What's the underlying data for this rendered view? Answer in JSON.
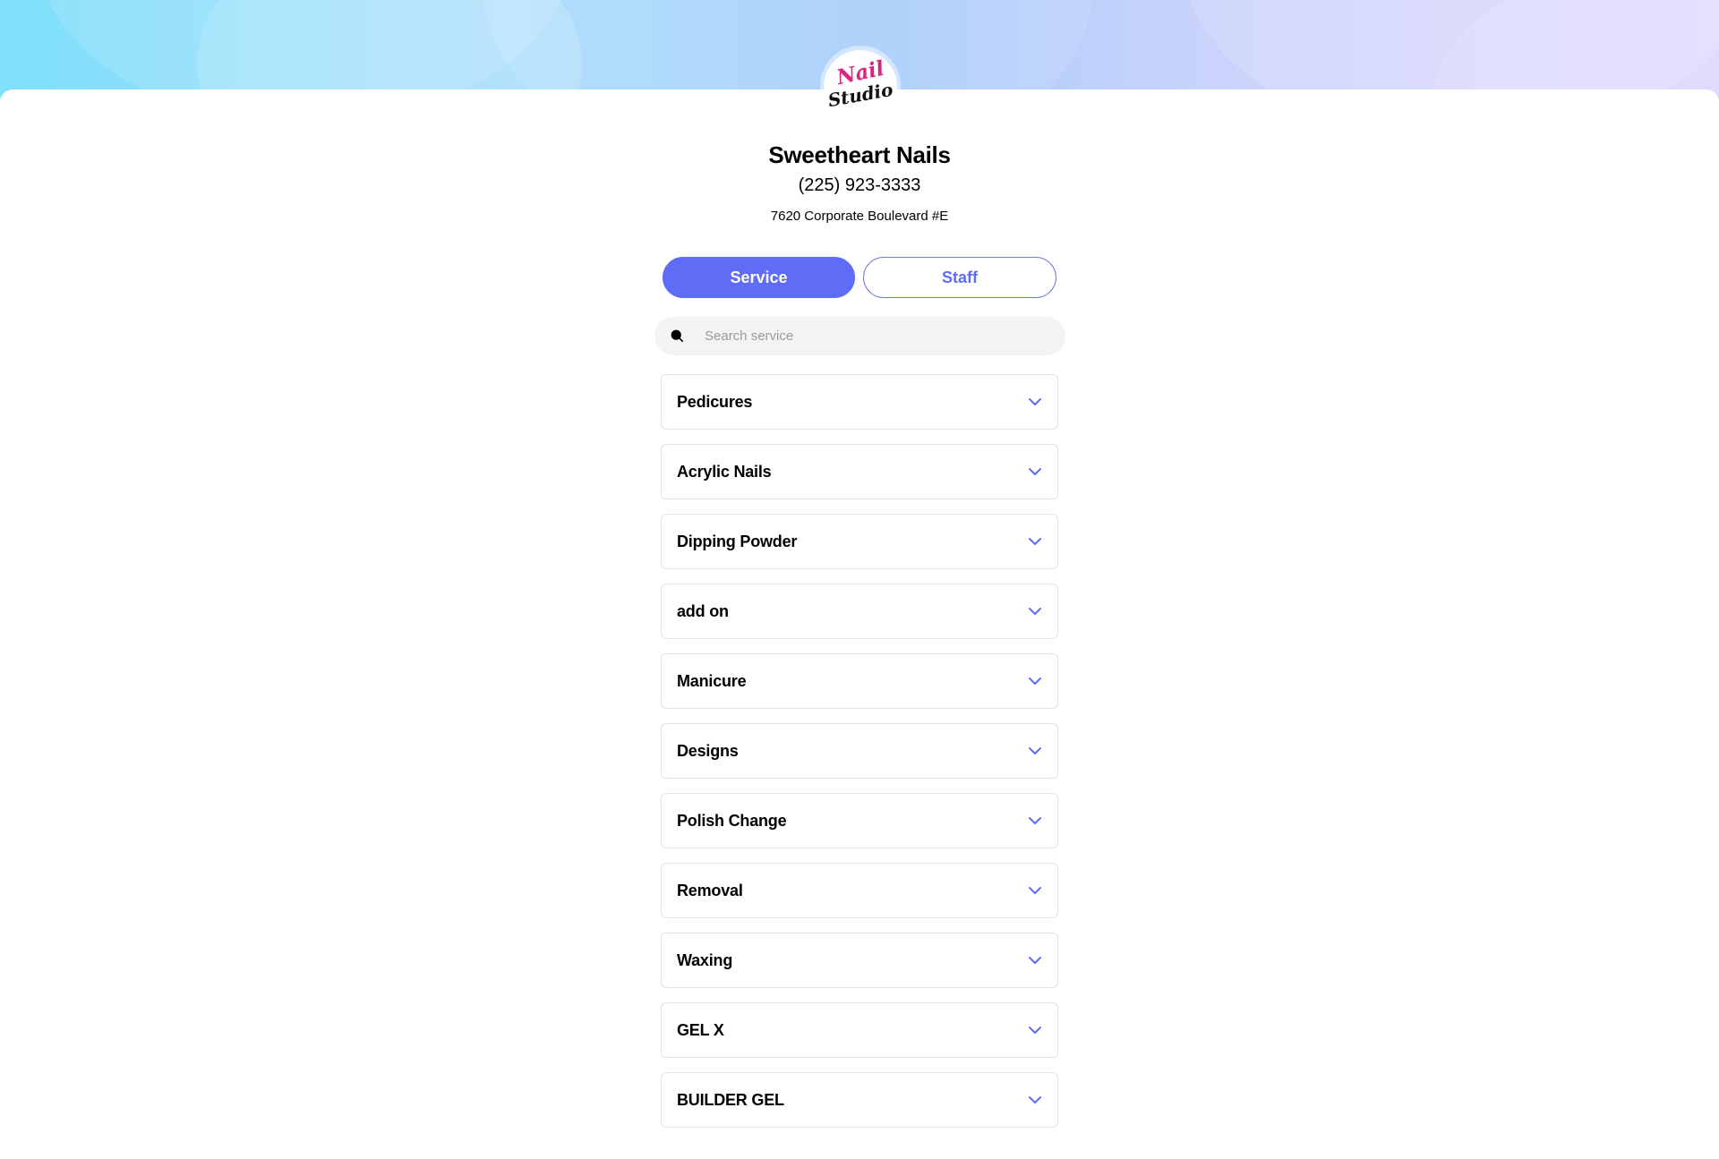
{
  "business": {
    "logo_text_top": "Nail",
    "logo_text_bottom": "Studio",
    "name": "Sweetheart Nails",
    "phone": "(225) 923-3333",
    "address": "7620 Corporate Boulevard #E"
  },
  "tabs": {
    "service_label": "Service",
    "staff_label": "Staff",
    "active": "Service"
  },
  "search": {
    "placeholder": "Search service",
    "value": ""
  },
  "categories": [
    {
      "label": "Pedicures"
    },
    {
      "label": "Acrylic Nails"
    },
    {
      "label": "Dipping Powder"
    },
    {
      "label": "add on"
    },
    {
      "label": "Manicure"
    },
    {
      "label": "Designs"
    },
    {
      "label": "Polish Change"
    },
    {
      "label": "Removal"
    },
    {
      "label": "Waxing"
    },
    {
      "label": "GEL X"
    },
    {
      "label": "BUILDER GEL"
    }
  ],
  "icons": {
    "search": "search-icon",
    "expand": "chevron-down-icon"
  },
  "colors": {
    "accent": "#5f6cf5",
    "logo_pink": "#d8257f",
    "chevron": "#5f6cf5"
  }
}
